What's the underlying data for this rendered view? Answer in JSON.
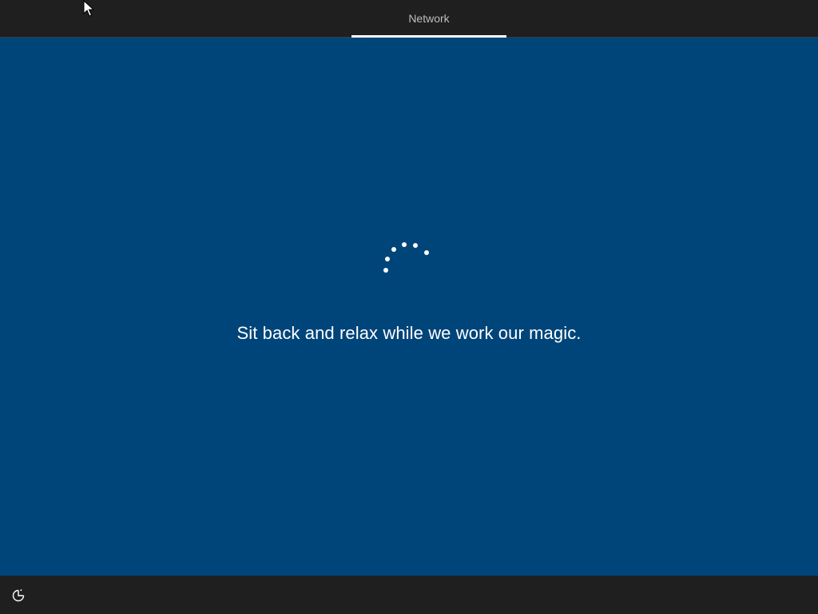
{
  "header": {
    "tab_label": "Network"
  },
  "main": {
    "message": "Sit back and relax while we work our magic.",
    "spinner_icon": "loading-spinner-icon"
  },
  "footer": {
    "ease_of_access_icon": "ease-of-access-icon"
  },
  "colors": {
    "background_blue": "#00457a",
    "bar_dark": "#1f1f1f",
    "text": "#ffffff"
  }
}
